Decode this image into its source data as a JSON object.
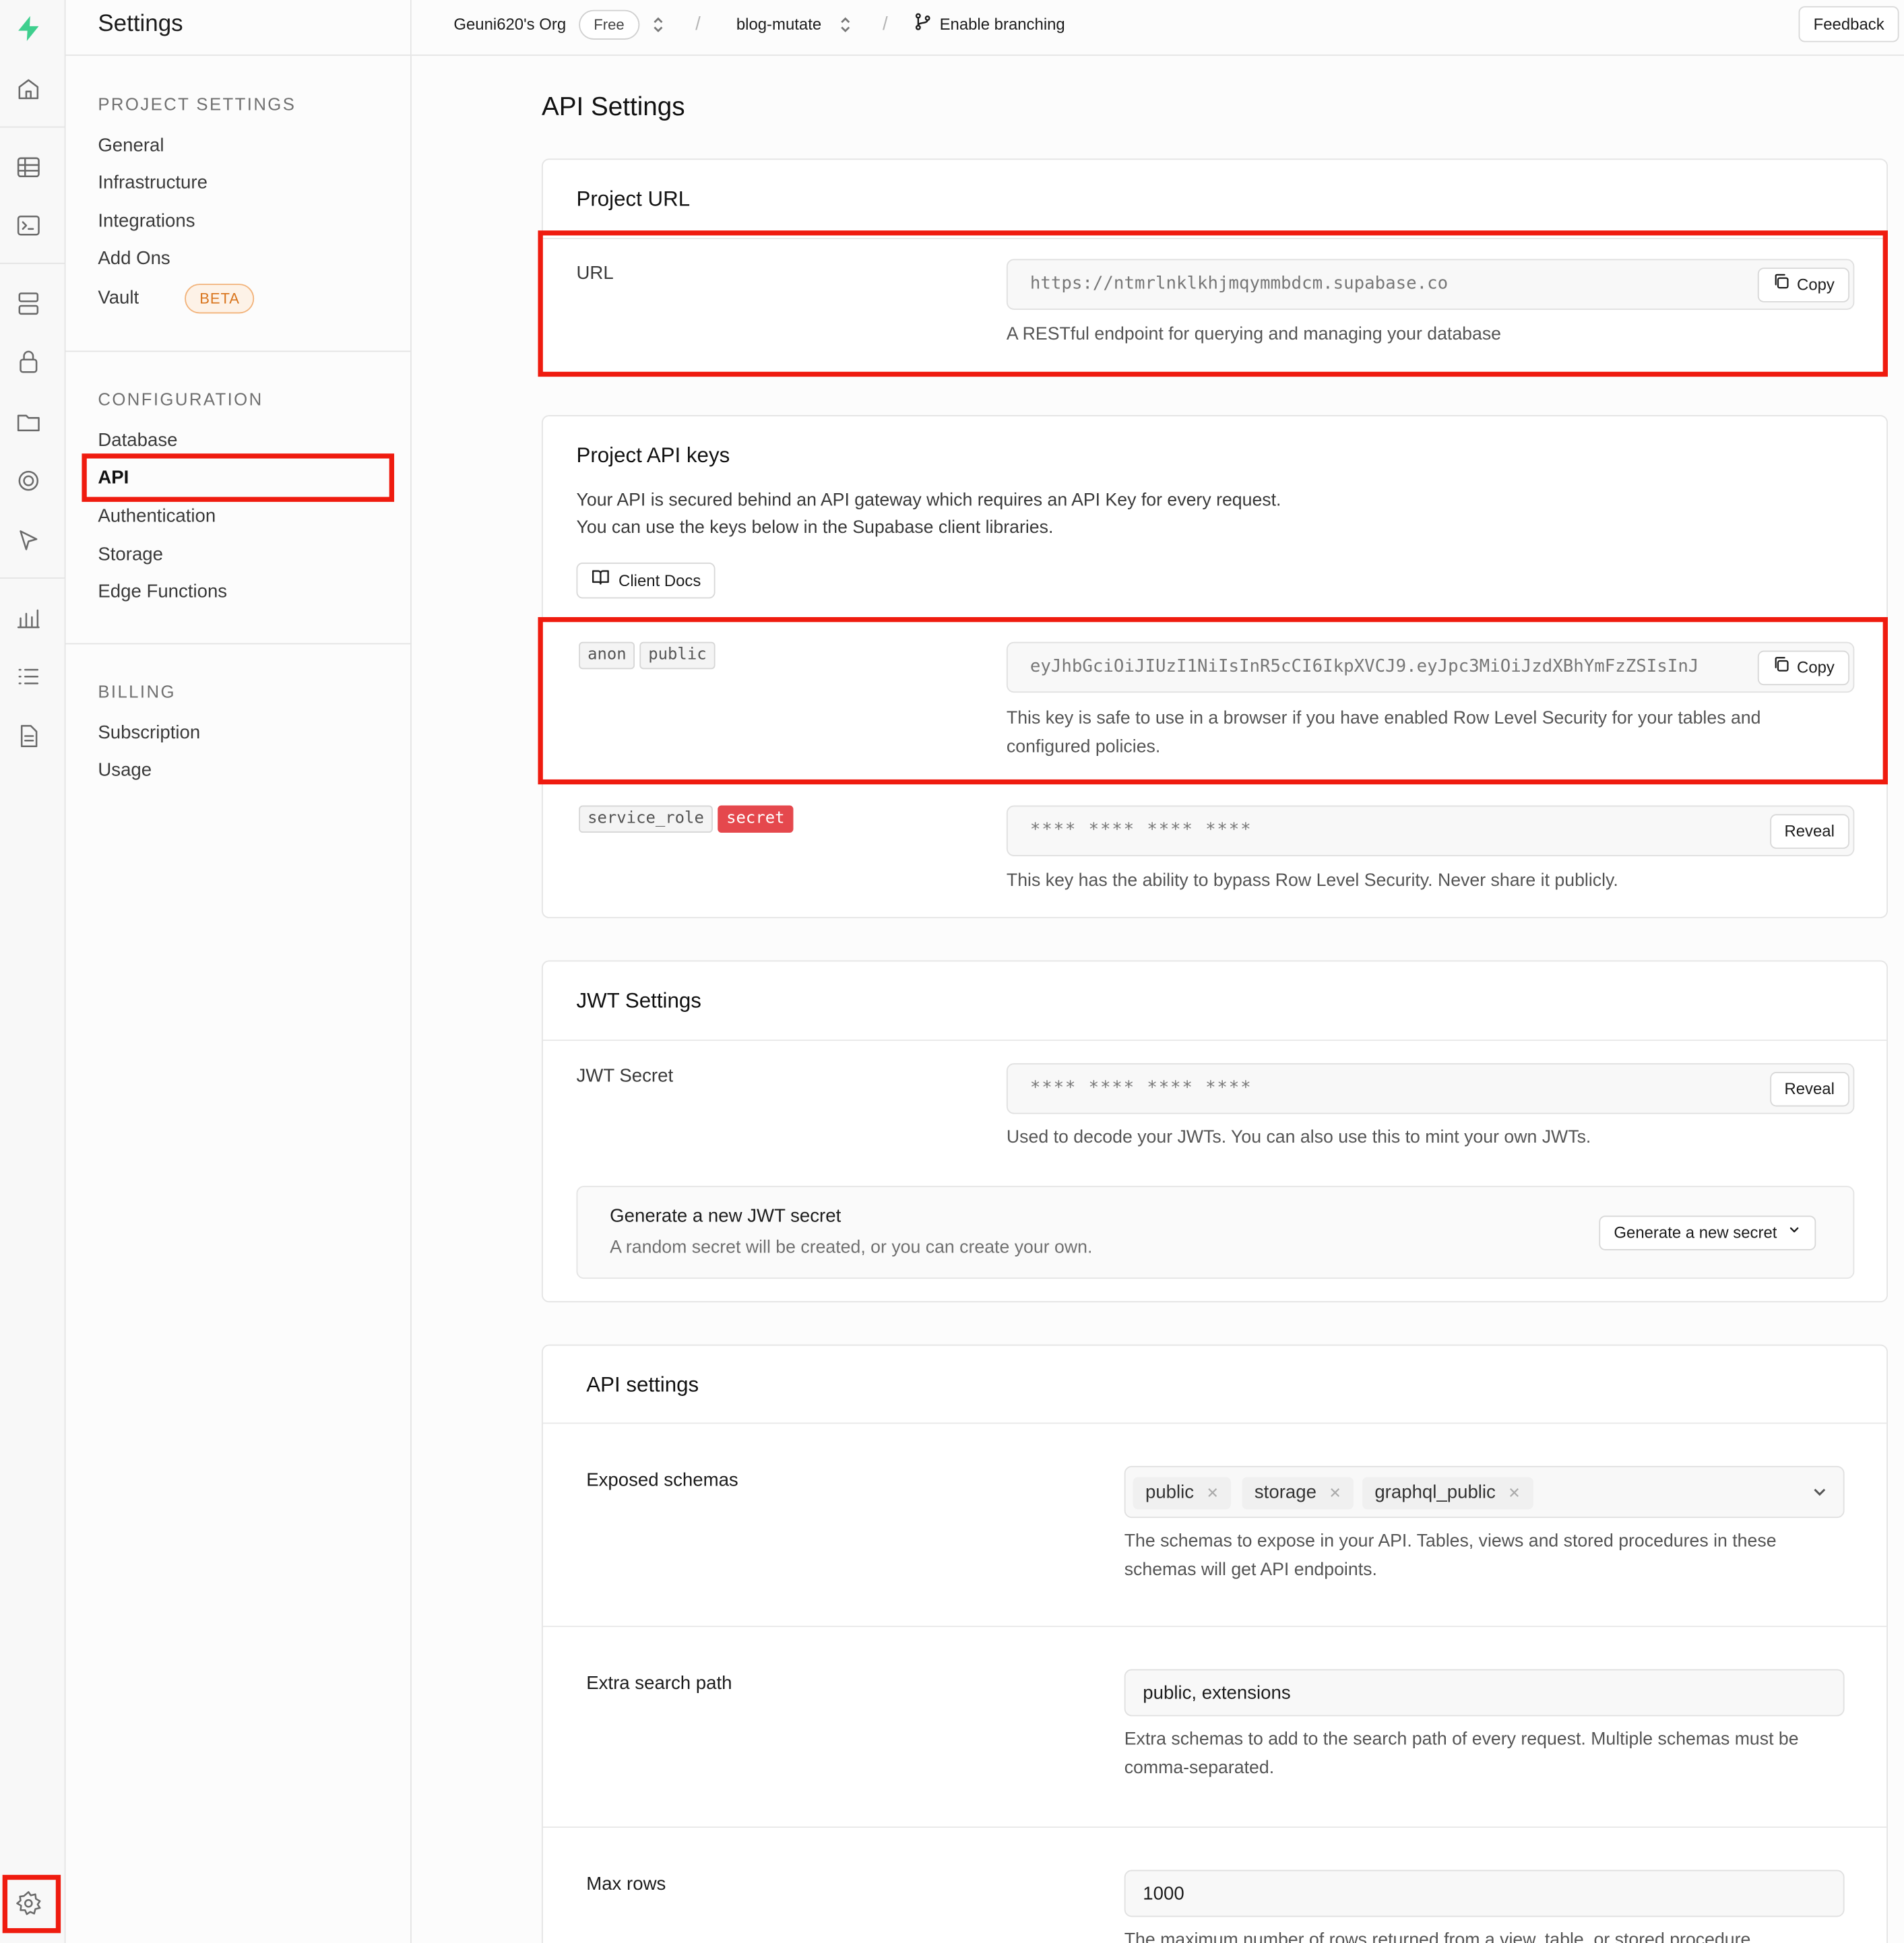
{
  "topbar": {
    "org": "Geuni620's Org",
    "plan": "Free",
    "project": "blog-mutate",
    "branching": "Enable branching",
    "feedback": "Feedback"
  },
  "sidebar": {
    "title": "Settings",
    "sections": [
      {
        "heading": "PROJECT SETTINGS",
        "items": [
          "General",
          "Infrastructure",
          "Integrations",
          "Add Ons",
          "Vault"
        ]
      },
      {
        "heading": "CONFIGURATION",
        "items": [
          "Database",
          "API",
          "Authentication",
          "Storage",
          "Edge Functions"
        ]
      },
      {
        "heading": "BILLING",
        "items": [
          "Subscription",
          "Usage"
        ]
      }
    ],
    "vault_badge": "BETA",
    "active_item": "API"
  },
  "page": {
    "title": "API Settings"
  },
  "project_url": {
    "title": "Project URL",
    "label": "URL",
    "value": "https://ntmrlnklkhjmqymmbdcm.supabase.co",
    "copy": "Copy",
    "description": "A RESTful endpoint for querying and managing your database"
  },
  "api_keys": {
    "title": "Project API keys",
    "intro_1": "Your API is secured behind an API gateway which requires an API Key for every request.",
    "intro_2": "You can use the keys below in the Supabase client libraries.",
    "client_docs": "Client Docs",
    "anon": {
      "tag1": "anon",
      "tag2": "public",
      "value": "eyJhbGciOiJIUzI1NiIsInR5cCI6IkpXVCJ9.eyJpc3MiOiJzdXBhYmFzZSIsInJ",
      "copy": "Copy",
      "description": "This key is safe to use in a browser if you have enabled Row Level Security for your tables and configured policies."
    },
    "service": {
      "tag1": "service_role",
      "tag2": "secret",
      "value": "**** **** **** ****",
      "reveal": "Reveal",
      "description": "This key has the ability to bypass Row Level Security. Never share it publicly."
    }
  },
  "jwt": {
    "title": "JWT Settings",
    "label": "JWT Secret",
    "value": "**** **** **** ****",
    "reveal": "Reveal",
    "description": "Used to decode your JWTs. You can also use this to mint your own JWTs.",
    "generate_title": "Generate a new JWT secret",
    "generate_desc": "A random secret will be created, or you can create your own.",
    "generate_button": "Generate a new secret"
  },
  "api_settings": {
    "title": "API settings",
    "exposed_label": "Exposed schemas",
    "schemas": [
      "public",
      "storage",
      "graphql_public"
    ],
    "exposed_desc": "The schemas to expose in your API. Tables, views and stored procedures in these schemas will get API endpoints.",
    "extra_label": "Extra search path",
    "extra_value": "public, extensions",
    "extra_desc": "Extra schemas to add to the search path of every request. Multiple schemas must be comma-separated.",
    "max_label": "Max rows",
    "max_value": "1000",
    "max_desc": "The maximum number of rows returned from a view, table, or stored procedure."
  },
  "colors": {
    "brand": "#3ecf8e",
    "highlight": "#ef1b0f",
    "secret_tag": "#e5484d",
    "beta": "#d9761f"
  }
}
